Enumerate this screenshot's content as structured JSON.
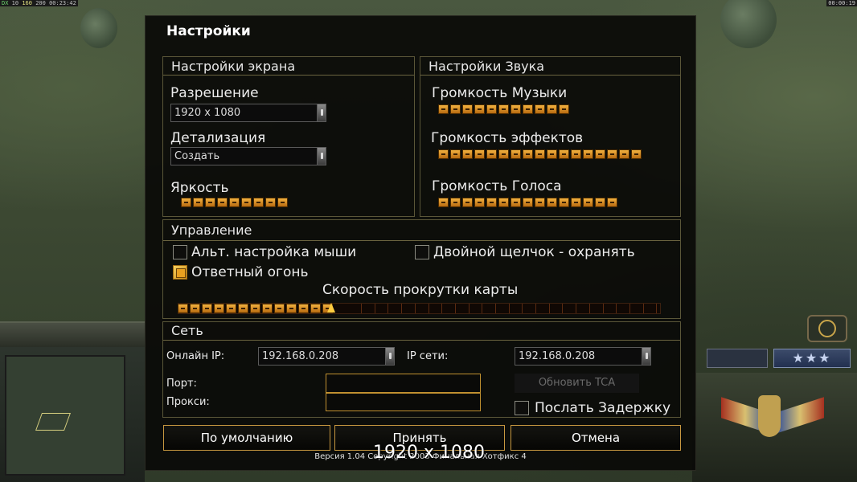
{
  "stats": {
    "left": [
      "10",
      "160",
      "200",
      "00:23:42"
    ],
    "right": "00:00:19"
  },
  "dialog": {
    "title": "Настройки",
    "screen": {
      "heading": "Настройки экрана",
      "resolution_label": "Разрешение",
      "resolution_value": "1920 x 1080",
      "detail_label": "Детализация",
      "detail_value": "Создать",
      "brightness_label": "Яркость",
      "brightness_level": 9
    },
    "sound": {
      "heading": "Настройки Звука",
      "music_label": "Громкость Музыки",
      "music_level": 11,
      "effects_label": "Громкость эффектов",
      "effects_level": 17,
      "voice_label": "Громкость Голоса",
      "voice_level": 15
    },
    "controls": {
      "heading": "Управление",
      "alt_mouse_label": "Альт. настройка мыши",
      "alt_mouse_checked": false,
      "double_click_label": "Двойной щелчок - охранять",
      "double_click_checked": false,
      "return_fire_label": "Ответный огонь",
      "return_fire_checked": true,
      "scroll_label": "Скорость прокрутки карты",
      "scroll_level": 13,
      "scroll_max": 36
    },
    "network": {
      "heading": "Сеть",
      "online_ip_label": "Онлайн IP:",
      "online_ip_value": "192.168.0.208",
      "network_ip_label": "IP сети:",
      "network_ip_value": "192.168.0.208",
      "port_label": "Порт:",
      "proxy_label": "Прокси:",
      "update_button": "Обновить TCA",
      "send_delay_label": "Послать Задержку",
      "send_delay_checked": false
    },
    "buttons": {
      "default": "По умолчанию",
      "accept": "Принять",
      "cancel": "Отмена"
    },
    "version": "Версия 1.04 Copyright 2003 Финальная Хотфикс 4",
    "overlay_resolution": "1920 x 1080"
  },
  "colors": {
    "accent": "#f0a030",
    "border": "#5a5638",
    "button_border": "#c89840"
  }
}
